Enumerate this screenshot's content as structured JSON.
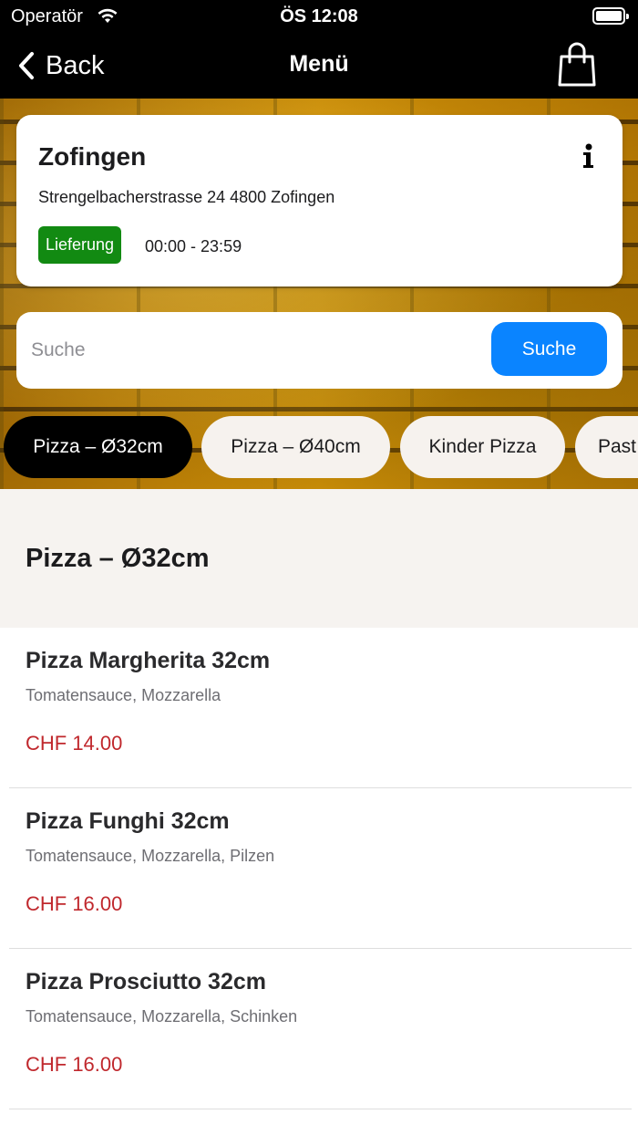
{
  "status_bar": {
    "carrier": "Operatör",
    "time": "ÖS 12:08"
  },
  "nav": {
    "back_label": "Back",
    "title": "Menü"
  },
  "store": {
    "name": "Zofingen",
    "address": "Strengelbacherstrasse 24 4800 Zofingen",
    "badge": "Lieferung",
    "hours": "00:00 - 23:59"
  },
  "search": {
    "placeholder": "Suche",
    "value": "",
    "button_label": "Suche"
  },
  "categories": [
    {
      "label": "Pizza – Ø32cm",
      "active": true
    },
    {
      "label": "Pizza – Ø40cm",
      "active": false
    },
    {
      "label": "Kinder Pizza",
      "active": false
    },
    {
      "label": "Past",
      "active": false
    }
  ],
  "section": {
    "title": "Pizza – Ø32cm"
  },
  "items": [
    {
      "name": "Pizza Margherita 32cm",
      "description": "Tomatensauce, Mozzarella",
      "price": "CHF 14.00"
    },
    {
      "name": "Pizza Funghi 32cm",
      "description": "Tomatensauce, Mozzarella, Pilzen",
      "price": "CHF 16.00"
    },
    {
      "name": "Pizza Prosciutto 32cm",
      "description": "Tomatensauce, Mozzarella, Schinken",
      "price": "CHF 16.00"
    }
  ],
  "colors": {
    "accent": "#0a84ff",
    "badge_green": "#128a12",
    "price_red": "#c0282d",
    "active_chip": "#000000"
  }
}
